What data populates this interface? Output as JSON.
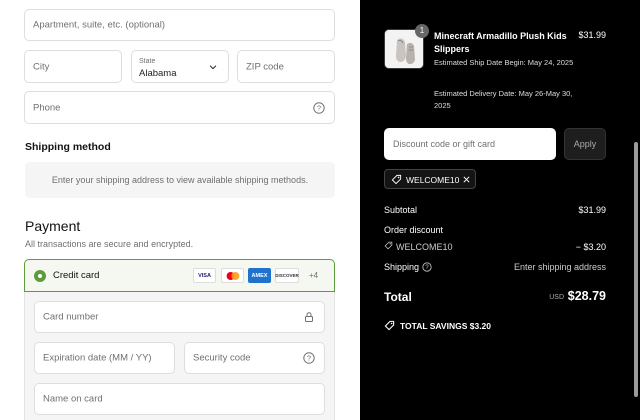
{
  "form": {
    "apartment_placeholder": "Apartment, suite, etc. (optional)",
    "city_placeholder": "City",
    "state": {
      "label": "State",
      "value": "Alabama"
    },
    "zip_placeholder": "ZIP code",
    "phone_placeholder": "Phone"
  },
  "shipping": {
    "heading": "Shipping method",
    "notice": "Enter your shipping address to view available shipping methods."
  },
  "payment": {
    "heading": "Payment",
    "note": "All transactions are secure and encrypted.",
    "method_label": "Credit card",
    "brands": [
      "VISA",
      "mastercard",
      "AMEX",
      "DISCOVER"
    ],
    "more_brands": "+4",
    "card_number_placeholder": "Card number",
    "expiration_placeholder": "Expiration date (MM / YY)",
    "security_placeholder": "Security code",
    "name_placeholder": "Name on card"
  },
  "summary": {
    "product": {
      "name": "Minecraft Armadillo Plush Kids Slippers",
      "price": "$31.99",
      "quantity": "1",
      "ship_date": "Estimated Ship Date Begin: May 24, 2025",
      "delivery_date": "Estimated Delivery Date: May 26-May 30, 2025"
    },
    "discount_placeholder": "Discount code or gift card",
    "apply_label": "Apply",
    "applied_code": "WELCOME10",
    "subtotal_label": "Subtotal",
    "subtotal_value": "$31.99",
    "order_discount_label": "Order discount",
    "discount_code": "WELCOME10",
    "discount_value": "− $3.20",
    "shipping_label": "Shipping",
    "shipping_value": "Enter shipping address",
    "total_label": "Total",
    "currency": "USD",
    "total_value": "$28.79",
    "savings": "TOTAL SAVINGS $3.20"
  },
  "colors": {
    "accent_green": "#5e9b3c",
    "summary_bg": "#000000"
  }
}
